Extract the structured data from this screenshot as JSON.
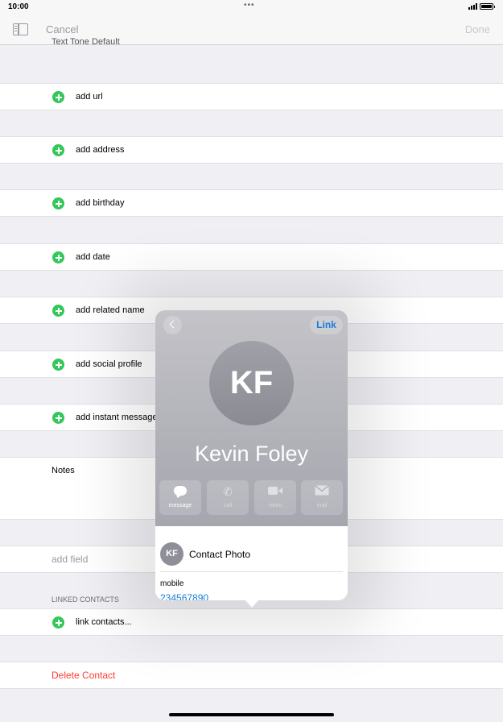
{
  "status": {
    "time": "10:00",
    "center": "•••"
  },
  "nav": {
    "cancel": "Cancel",
    "done": "Done"
  },
  "partial_row": "Text Tone  Default",
  "form": {
    "add_rows": [
      "add url",
      "add address",
      "add birthday",
      "add date",
      "add related name",
      "add social profile",
      "add instant message"
    ],
    "notes_label": "Notes",
    "add_field": "add field",
    "linked_header": "LINKED CONTACTS",
    "link_contacts": "link contacts...",
    "delete": "Delete Contact"
  },
  "popover": {
    "back_icon": "chevron-left-icon",
    "link_label": "Link",
    "initials": "KF",
    "name": "Kevin Foley",
    "actions": [
      {
        "label": "message",
        "icon": "message-icon",
        "enabled": true
      },
      {
        "label": "call",
        "icon": "phone-icon",
        "enabled": false
      },
      {
        "label": "video",
        "icon": "video-icon",
        "enabled": false
      },
      {
        "label": "mail",
        "icon": "mail-icon",
        "enabled": false
      }
    ],
    "photo_label": "Contact Photo",
    "phone_type": "mobile",
    "phone_number": "234567890"
  },
  "colors": {
    "accent": "#1c7ed6",
    "add_green": "#34c759",
    "destructive": "#ff3b30"
  }
}
